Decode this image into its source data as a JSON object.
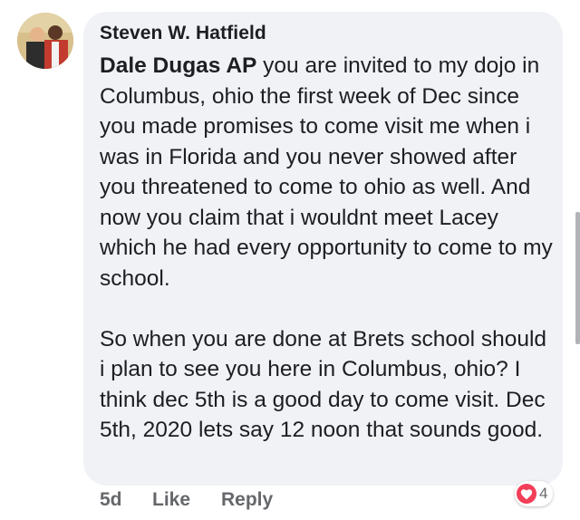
{
  "comment": {
    "author": "Steven W. Hatfield",
    "mention": "Dale Dugas AP",
    "paragraph1": " you are invited to my dojo in Columbus, ohio the first week of Dec since you made promises to come visit me when i was in Florida and you never showed after you threatened to come to ohio as well. And now you claim that i wouldnt meet Lacey which he had every opportunity to come to my school.",
    "paragraph2": "So when you are done at Brets school should i plan to see you here in Columbus, ohio?  I think dec 5th is a good day to come visit.  Dec 5th, 2020 lets say 12 noon that sounds good."
  },
  "actions": {
    "time": "5d",
    "like": "Like",
    "reply": "Reply"
  },
  "reactions": {
    "icon": "heart-icon",
    "count": "4",
    "color": "#f33e58"
  }
}
